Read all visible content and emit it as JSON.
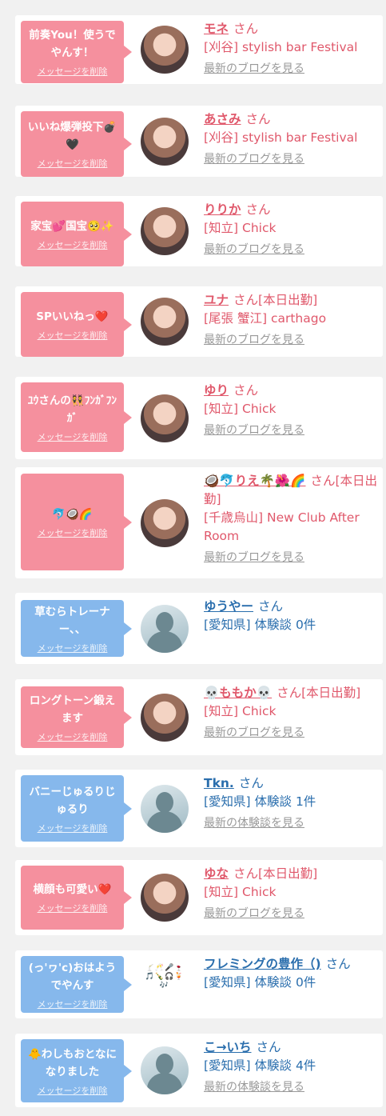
{
  "cards": [
    {
      "color": "pink",
      "message": "前奏You！使うでやんす！",
      "delete_label": "メッセージを削除",
      "name": "モネ",
      "suffix": "さん",
      "shop": "[刈谷] stylish bar Festival",
      "link": "最新のブログを見る",
      "avatar": "photo"
    },
    {
      "color": "pink",
      "message": "いいね爆弾投下💣🖤",
      "delete_label": "メッセージを削除",
      "name": "あさみ",
      "suffix": "さん",
      "shop": "[刈谷] stylish bar Festival",
      "link": "最新のブログを見る",
      "avatar": "photo"
    },
    {
      "color": "pink",
      "message": "家宝💕国宝🥺✨",
      "delete_label": "メッセージを削除",
      "name": "りりか",
      "suffix": "さん",
      "shop": "[知立] Chick",
      "link": "最新のブログを見る",
      "avatar": "photo"
    },
    {
      "color": "pink",
      "message": "SPいいねっ❤️",
      "delete_label": "メッセージを削除",
      "name": "ユナ",
      "suffix": "さん[本日出勤]",
      "shop": "[尾張 蟹江] carthago",
      "link": "最新のブログを見る",
      "avatar": "photo"
    },
    {
      "color": "pink",
      "message": "ﾕｳさんの👯ﾌﾝｶﾞﾌﾝｶﾞ",
      "delete_label": "メッセージを削除",
      "name": "ゆり",
      "suffix": "さん",
      "shop": "[知立] Chick",
      "link": "最新のブログを見る",
      "avatar": "photo"
    },
    {
      "color": "pink",
      "message": "🐬🥥🌈",
      "delete_label": "メッセージを削除",
      "name": "🥥🐬りえ🌴🌺🌈",
      "suffix": "さん[本日出勤]",
      "shop": "[千歳烏山] New Club After Room",
      "link": "最新のブログを見る",
      "avatar": "photo"
    },
    {
      "color": "blue",
      "message": "草むらトレーナー、、",
      "delete_label": "メッセージを削除",
      "name": "ゆうやー",
      "suffix": "さん",
      "shop": "[愛知県] 体験談 0件",
      "link": "",
      "avatar": "nophoto"
    },
    {
      "color": "pink",
      "message": "ロングトーン鍛えます",
      "delete_label": "メッセージを削除",
      "name": "💀ももか💀",
      "suffix": "さん[本日出勤]",
      "shop": "[知立] Chick",
      "link": "最新のブログを見る",
      "avatar": "photo"
    },
    {
      "color": "blue",
      "message": "バニーじゅるりじゅるり",
      "delete_label": "メッセージを削除",
      "name": "Tkn.",
      "suffix": "さん",
      "shop": "[愛知県] 体験談 1件",
      "link": "最新の体験談を見る",
      "avatar": "nophoto"
    },
    {
      "color": "pink",
      "message": "横顔も可愛い❤️",
      "delete_label": "メッセージを削除",
      "name": "ゆな",
      "suffix": "さん[本日出勤]",
      "shop": "[知立] Chick",
      "link": "最新のブログを見る",
      "avatar": "photo"
    },
    {
      "color": "blue",
      "message": "(っ'ヮ'c)おはようでやんす",
      "delete_label": "メッセージを削除",
      "name": "フレミングの豊作（)",
      "suffix": "さん",
      "shop": "[愛知県] 体験談 0件",
      "link": "",
      "avatar": "icons"
    },
    {
      "color": "blue",
      "message": "🐥わしもおとなになりました",
      "delete_label": "メッセージを削除",
      "name": "こ→いち",
      "suffix": "さん",
      "shop": "[愛知県] 体験談 4件",
      "link": "最新の体験談を見る",
      "avatar": "nophoto"
    }
  ]
}
